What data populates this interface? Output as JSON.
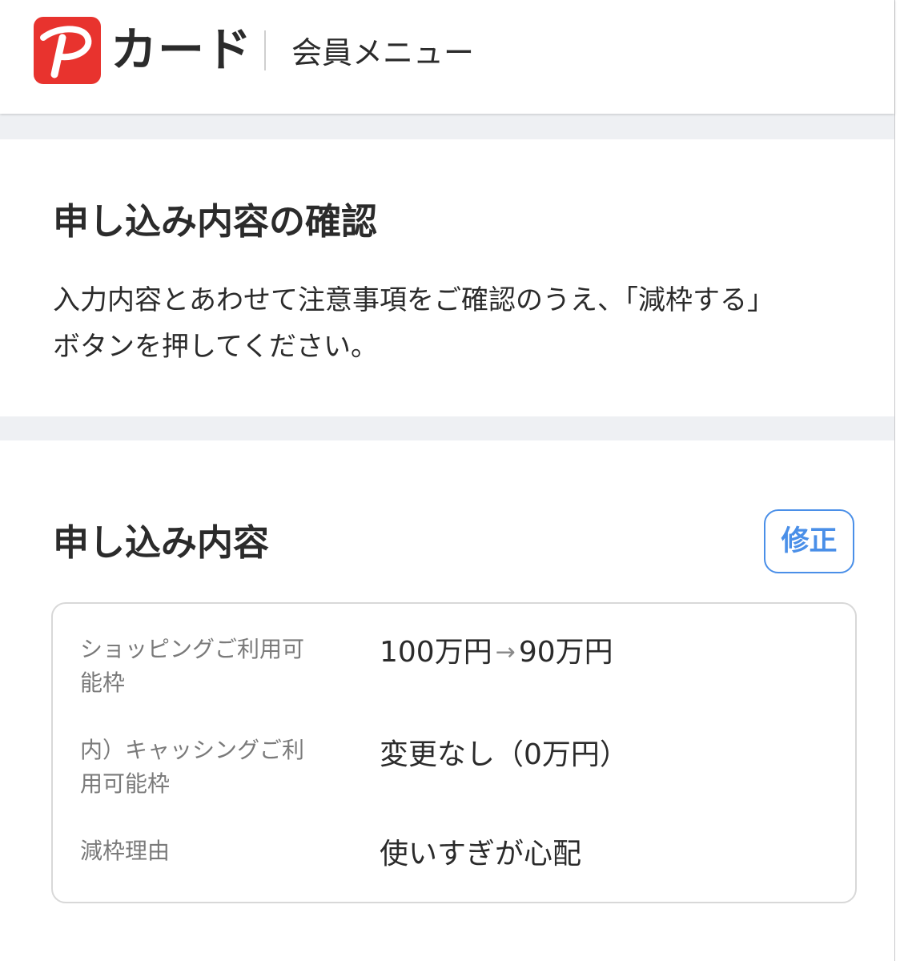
{
  "header": {
    "brand_label": "カード",
    "menu_label": "会員メニュー",
    "brand_color": "#e8332e",
    "logo_icon": "paypay-p-logo-icon"
  },
  "confirm_section": {
    "title": "申し込み内容の確認",
    "description_line1": "入力内容とあわせて注意事項をご確認のうえ、「減枠する」",
    "description_line2": "ボタンを押してください。"
  },
  "content_section": {
    "title": "申し込み内容",
    "edit_button_label": "修正",
    "accent_color": "#4a8fe8",
    "rows": [
      {
        "label_line1": "ショッピングご利用可",
        "label_line2": "能枠",
        "value_before": "100万円",
        "value_after": "90万円",
        "arrow_icon": "arrow-right-icon"
      },
      {
        "label_line1": "内）キャッシングご利",
        "label_line2": "用可能枠",
        "value": "変更なし（0万円）"
      },
      {
        "label_line1": "減枠理由",
        "value": "使いすぎが心配"
      }
    ]
  }
}
